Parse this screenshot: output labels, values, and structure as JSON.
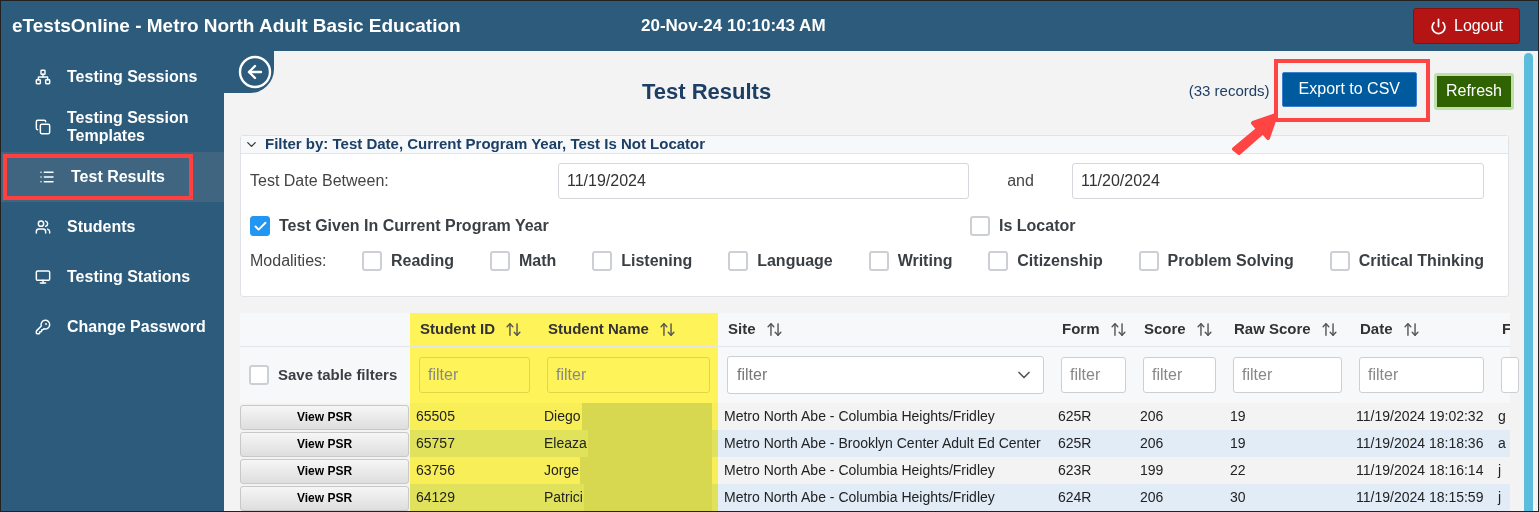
{
  "app_title": "eTestsOnline - Metro North Adult Basic Education",
  "datetime": "20-Nov-24 10:10:43 AM",
  "logout": {
    "label": "Logout"
  },
  "sidebar": {
    "items": [
      {
        "label": "Testing Sessions",
        "kind": "sessions",
        "selected": false,
        "highlighted": false
      },
      {
        "label": "Testing Session Templates",
        "kind": "templates",
        "selected": false,
        "highlighted": false
      },
      {
        "label": "Test Results",
        "kind": "results",
        "selected": true,
        "highlighted": true
      },
      {
        "label": "Students",
        "kind": "students",
        "selected": false,
        "highlighted": false
      },
      {
        "label": "Testing Stations",
        "kind": "stations",
        "selected": false,
        "highlighted": false
      },
      {
        "label": "Change Password",
        "kind": "password",
        "selected": false,
        "highlighted": false
      }
    ]
  },
  "page": {
    "title": "Test Results",
    "records": "(33 records)",
    "buttons": [
      {
        "label": "Export to CSV",
        "kind": "primary",
        "highlighted": true
      },
      {
        "label": "Refresh",
        "kind": "success",
        "highlighted": false
      }
    ]
  },
  "filter": {
    "summary": "Filter by: Test Date, Current Program Year, Test Is Not Locator",
    "expanded": true,
    "date_label": "Test Date Between:",
    "date_from": "11/19/2024",
    "and": "and",
    "date_to": "11/20/2024",
    "current_year": {
      "label": "Test Given In Current Program Year",
      "checked": true
    },
    "is_locator": {
      "label": "Is Locator",
      "checked": false
    },
    "modalities_label": "Modalities:",
    "modalities": [
      {
        "label": "Reading",
        "checked": false
      },
      {
        "label": "Math",
        "checked": false
      },
      {
        "label": "Listening",
        "checked": false
      },
      {
        "label": "Language",
        "checked": false
      },
      {
        "label": "Writing",
        "checked": false
      },
      {
        "label": "Citizenship",
        "checked": false
      },
      {
        "label": "Problem Solving",
        "checked": false
      },
      {
        "label": "Critical Thinking",
        "checked": false
      }
    ]
  },
  "table": {
    "save_filters": {
      "label": "Save table filters",
      "checked": false
    },
    "columns": [
      {
        "label": "Student ID",
        "highlighted": true,
        "filter": {
          "kind": "text",
          "placeholder": "filter"
        }
      },
      {
        "label": "Student Name",
        "highlighted": true,
        "blurred": true,
        "filter": {
          "kind": "text",
          "placeholder": "filter"
        }
      },
      {
        "label": "Site",
        "highlighted": false,
        "filter": {
          "kind": "select",
          "placeholder": "filter"
        }
      },
      {
        "label": "Form",
        "highlighted": false,
        "filter": {
          "kind": "text",
          "placeholder": "filter"
        }
      },
      {
        "label": "Score",
        "highlighted": false,
        "filter": {
          "kind": "text",
          "placeholder": "filter"
        }
      },
      {
        "label": "Raw Score",
        "highlighted": false,
        "filter": {
          "kind": "text",
          "placeholder": "filter"
        }
      },
      {
        "label": "Date",
        "highlighted": false,
        "filter": {
          "kind": "text",
          "placeholder": "filter"
        }
      },
      {
        "label": "F",
        "highlighted": false,
        "filter": {
          "kind": "text"
        }
      }
    ],
    "rows": [
      {
        "action": "View PSR",
        "cells": [
          "65505",
          "Diego",
          "Metro North Abe - Columbia Heights/Fridley",
          "625R",
          "206",
          "19",
          "11/19/2024 19:02:32",
          "g"
        ]
      },
      {
        "action": "View PSR",
        "cells": [
          "65757",
          "Eleaza",
          "Metro North Abe - Brooklyn Center Adult Ed Center",
          "625R",
          "206",
          "19",
          "11/19/2024 18:18:36",
          "a"
        ]
      },
      {
        "action": "View PSR",
        "cells": [
          "63756",
          "Jorge",
          "Metro North Abe - Columbia Heights/Fridley",
          "623R",
          "199",
          "22",
          "11/19/2024 18:16:14",
          "j"
        ]
      },
      {
        "action": "View PSR",
        "cells": [
          "64129",
          "Patrici",
          "Metro North Abe - Columbia Heights/Fridley",
          "624R",
          "206",
          "30",
          "11/19/2024 18:15:59",
          "j"
        ]
      }
    ]
  }
}
